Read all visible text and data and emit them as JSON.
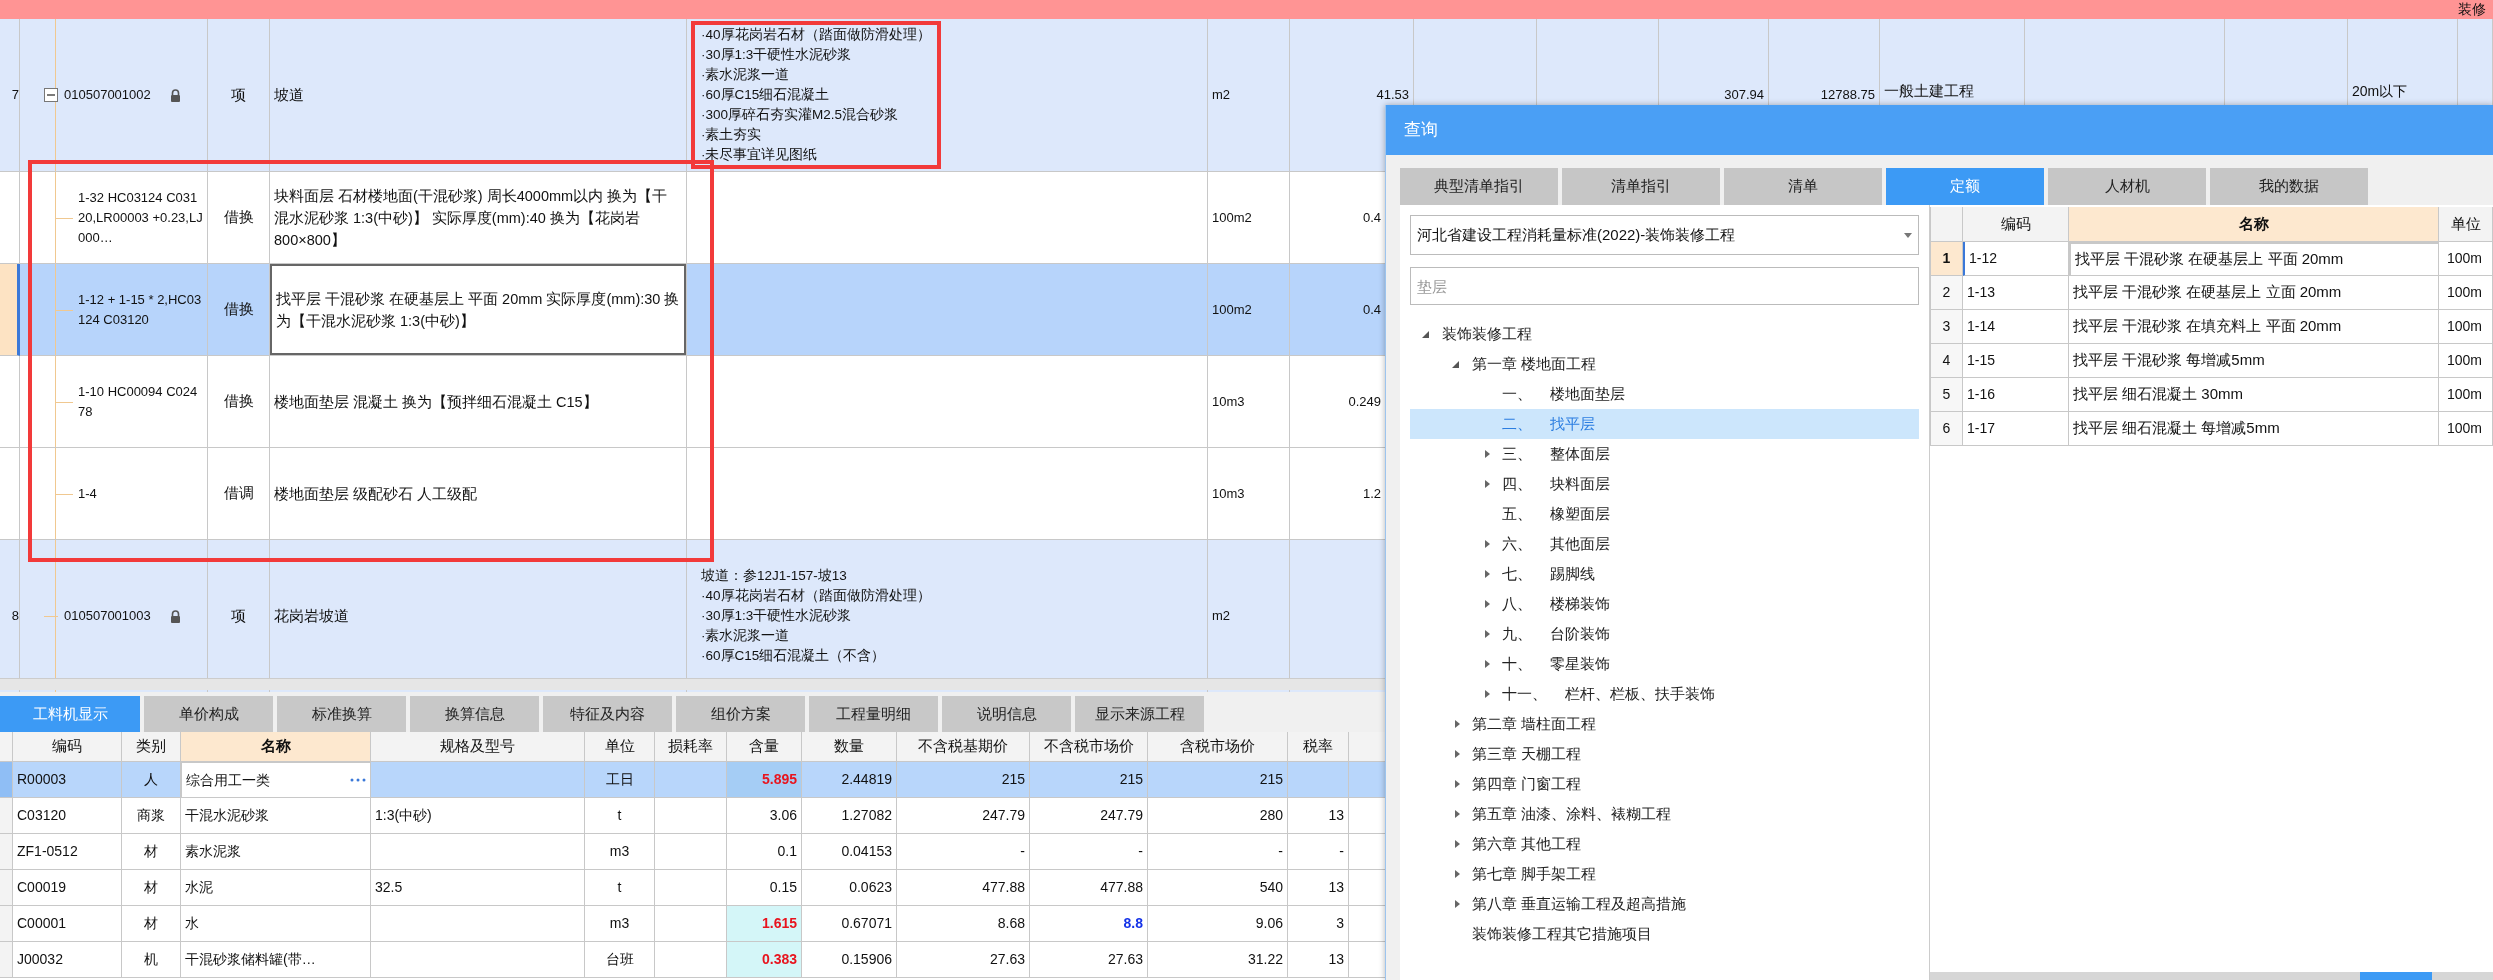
{
  "main_table": {
    "section_row": {
      "text": "装修"
    },
    "rows": [
      {
        "number": "7",
        "code": "010507001002",
        "expanded": true,
        "locked": true,
        "type": "项",
        "name": "坡道",
        "features": [
          "·40厚花岗岩石材（踏面做防滑处理）",
          "·30厚1:3干硬性水泥砂浆",
          "·素水泥浆一道",
          "·60厚C15细石混凝土",
          "·300厚碎石夯实灌M2.5混合砂浆",
          "·素土夯实",
          "·未尽事宜详见图纸"
        ],
        "features_highlighted": true,
        "unit": "m2",
        "quantity": "41.53",
        "unit_price": "307.94",
        "total": "12788.75",
        "category": "一般土建工程",
        "height": "20m以下",
        "children_highlighted": true,
        "children": [
          {
            "code": "1-32 HC03124 C03120,LR00003 +0.23,LJ000…",
            "type": "借换",
            "name": "块料面层 石材楼地面(干混砂浆) 周长4000mm以内 换为【干混水泥砂浆 1:3(中砂)】 实际厚度(mm):40 换为【花岗岩800×800】",
            "unit": "100m2",
            "quantity": "0.4",
            "selected": false
          },
          {
            "code": "1-12 + 1-15 * 2,HC03124 C03120",
            "type": "借换",
            "name": "找平层 干混砂浆 在硬基层上 平面 20mm 实际厚度(mm):30 换为【干混水泥砂浆 1:3(中砂)】",
            "unit": "100m2",
            "quantity": "0.4",
            "selected": true
          },
          {
            "code": "1-10 HC00094 C02478",
            "type": "借换",
            "name": "楼地面垫层 混凝土 换为【预拌细石混凝土 C15】",
            "unit": "10m3",
            "quantity": "0.249",
            "selected": false
          },
          {
            "code": "1-4",
            "type": "借调",
            "name": "楼地面垫层 级配砂石 人工级配",
            "unit": "10m3",
            "quantity": "1.2",
            "selected": false
          }
        ]
      },
      {
        "number": "8",
        "code": "010507001003",
        "locked": true,
        "type": "项",
        "name": "花岗岩坡道",
        "features": [
          "坡道：参12J1-157-坡13",
          "·40厚花岗岩石材（踏面做防滑处理）",
          "·30厚1:3干硬性水泥砂浆",
          "·素水泥浆一道",
          "·60厚C15细石混凝土（不含）"
        ],
        "features_highlighted": false,
        "unit": "m2",
        "children": []
      }
    ]
  },
  "bottom_tabs": [
    {
      "label": "工料机显示",
      "selected": true
    },
    {
      "label": "单价构成",
      "selected": false
    },
    {
      "label": "标准换算",
      "selected": false
    },
    {
      "label": "换算信息",
      "selected": false
    },
    {
      "label": "特征及内容",
      "selected": false
    },
    {
      "label": "组价方案",
      "selected": false
    },
    {
      "label": "工程量明细",
      "selected": false
    },
    {
      "label": "说明信息",
      "selected": false
    },
    {
      "label": "显示来源工程",
      "selected": false
    }
  ],
  "resource_table": {
    "columns": [
      {
        "label": "编码",
        "selected": false
      },
      {
        "label": "类别",
        "selected": false
      },
      {
        "label": "名称",
        "selected": true
      },
      {
        "label": "规格及型号",
        "selected": false
      },
      {
        "label": "单位",
        "selected": false
      },
      {
        "label": "损耗率",
        "selected": false
      },
      {
        "label": "含量",
        "selected": false
      },
      {
        "label": "数量",
        "selected": false
      },
      {
        "label": "不含税基期价",
        "selected": false
      },
      {
        "label": "不含税市场价",
        "selected": false
      },
      {
        "label": "含税市场价",
        "selected": false
      },
      {
        "label": "税率",
        "selected": false
      }
    ],
    "rows": [
      {
        "code": "R00003",
        "type": "人",
        "name": "综合用工一类",
        "unit": "工日",
        "content": "5.895",
        "quantity": "2.44819",
        "base_price": "215",
        "market_price": "215",
        "market_price_tax": "215",
        "content_changed": true,
        "price_changed": false,
        "selected": true
      },
      {
        "code": "C03120",
        "type": "商浆",
        "name": "干混水泥砂浆",
        "spec": "1:3(中砂)",
        "unit": "t",
        "content": "3.06",
        "quantity": "1.27082",
        "base_price": "247.79",
        "market_price": "247.79",
        "market_price_tax": "280",
        "tax_rate": "13",
        "content_changed": false,
        "price_changed": false,
        "selected": false
      },
      {
        "code": "ZF1-0512",
        "type": "材",
        "name": "素水泥浆",
        "unit": "m3",
        "content": "0.1",
        "quantity": "0.04153",
        "base_price": "-",
        "market_price": "-",
        "market_price_tax": "-",
        "tax_rate": "-",
        "content_changed": false,
        "price_changed": false,
        "selected": false
      },
      {
        "code": "C00019",
        "type": "材",
        "name": "水泥",
        "spec": "32.5",
        "unit": "t",
        "content": "0.15",
        "quantity": "0.0623",
        "base_price": "477.88",
        "market_price": "477.88",
        "market_price_tax": "540",
        "tax_rate": "13",
        "content_changed": false,
        "price_changed": false,
        "selected": false
      },
      {
        "code": "C00001",
        "type": "材",
        "name": "水",
        "unit": "m3",
        "content": "1.615",
        "quantity": "0.67071",
        "base_price": "8.68",
        "market_price": "8.8",
        "market_price_tax": "9.06",
        "tax_rate": "3",
        "content_changed": true,
        "price_changed": true,
        "selected": false
      },
      {
        "code": "J00032",
        "type": "机",
        "name": "干混砂浆储料罐(带…",
        "unit": "台班",
        "content": "0.383",
        "quantity": "0.15906",
        "base_price": "27.63",
        "market_price": "27.63",
        "market_price_tax": "31.22",
        "tax_rate": "13",
        "content_changed": true,
        "price_changed": false,
        "selected": false
      }
    ]
  },
  "query_dialog": {
    "title": "查询",
    "tabs": [
      {
        "label": "典型清单指引",
        "selected": false
      },
      {
        "label": "清单指引",
        "selected": false
      },
      {
        "label": "清单",
        "selected": false
      },
      {
        "label": "定额",
        "selected": true
      },
      {
        "label": "人材机",
        "selected": false
      },
      {
        "label": "我的数据",
        "selected": false
      }
    ],
    "library": "河北省建设工程消耗量标准(2022)-装饰装修工程",
    "search": {
      "placeholder": "垫层"
    },
    "tree": [
      {
        "label": "装饰装修工程",
        "expanded": true,
        "selected": false,
        "children": [
          {
            "label": "第一章 楼地面工程",
            "expanded": true,
            "selected": false,
            "children": [
              {
                "index": "一、",
                "label": "楼地面垫层",
                "selected": false
              },
              {
                "index": "二、",
                "label": "找平层",
                "selected": true
              },
              {
                "index": "三、",
                "label": "整体面层",
                "expanded": false,
                "selected": false
              },
              {
                "index": "四、",
                "label": "块料面层",
                "expanded": false,
                "selected": false
              },
              {
                "index": "五、",
                "label": "橡塑面层",
                "selected": false
              },
              {
                "index": "六、",
                "label": "其他面层",
                "expanded": false,
                "selected": false
              },
              {
                "index": "七、",
                "label": "踢脚线",
                "expanded": false,
                "selected": false
              },
              {
                "index": "八、",
                "label": "楼梯装饰",
                "expanded": false,
                "selected": false
              },
              {
                "index": "九、",
                "label": "台阶装饰",
                "expanded": false,
                "selected": false
              },
              {
                "index": "十、",
                "label": "零星装饰",
                "expanded": false,
                "selected": false
              },
              {
                "index": "十一、",
                "label": "栏杆、栏板、扶手装饰",
                "expanded": false,
                "selected": false
              }
            ]
          },
          {
            "label": "第二章 墙柱面工程",
            "expanded": false,
            "selected": false
          },
          {
            "label": "第三章 天棚工程",
            "expanded": false,
            "selected": false
          },
          {
            "label": "第四章 门窗工程",
            "expanded": false,
            "selected": false
          },
          {
            "label": "第五章 油漆、涂料、裱糊工程",
            "expanded": false,
            "selected": false
          },
          {
            "label": "第六章 其他工程",
            "expanded": false,
            "selected": false
          },
          {
            "label": "第七章 脚手架工程",
            "expanded": false,
            "selected": false
          },
          {
            "label": "第八章 垂直运输工程及超高措施",
            "expanded": false,
            "selected": false
          },
          {
            "label": "装饰装修工程其它措施项目",
            "selected": false
          }
        ]
      }
    ],
    "grid": {
      "columns": [
        {
          "label": "编码",
          "selected": false
        },
        {
          "label": "名称",
          "selected": true
        },
        {
          "label": "单位",
          "selected": false
        }
      ],
      "rows": [
        {
          "number": "1",
          "code": "1-12",
          "name": "找平层 干混砂浆 在硬基层上 平面 20mm",
          "unit": "100m",
          "selected": true
        },
        {
          "number": "2",
          "code": "1-13",
          "name": "找平层 干混砂浆 在硬基层上 立面 20mm",
          "unit": "100m",
          "selected": false
        },
        {
          "number": "3",
          "code": "1-14",
          "name": "找平层 干混砂浆 在填充料上 平面 20mm",
          "unit": "100m",
          "selected": false
        },
        {
          "number": "4",
          "code": "1-15",
          "name": "找平层 干混砂浆 每增减5mm",
          "unit": "100m",
          "selected": false
        },
        {
          "number": "5",
          "code": "1-16",
          "name": "找平层 细石混凝土 30mm",
          "unit": "100m",
          "selected": false
        },
        {
          "number": "6",
          "code": "1-17",
          "name": "找平层 细石混凝土 每增减5mm",
          "unit": "100m",
          "selected": false
        }
      ]
    }
  }
}
